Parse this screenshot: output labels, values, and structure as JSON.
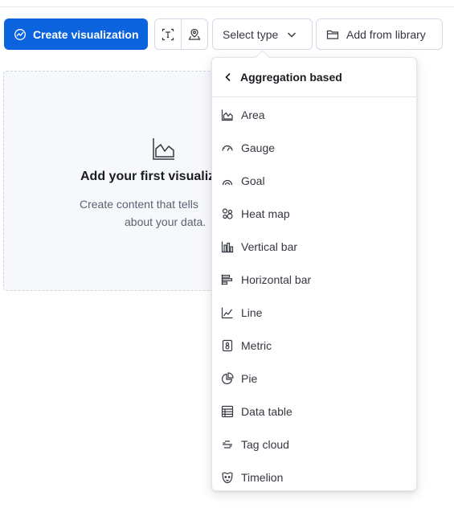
{
  "toolbar": {
    "create_label": "Create visualization",
    "select_label": "Select type",
    "library_label": "Add from library",
    "icons": [
      "text-icon",
      "map-icon"
    ]
  },
  "empty_state": {
    "title": "Add your first visualiz",
    "description_line1": "Create content that tells",
    "description_line2": "about your data."
  },
  "dropdown": {
    "title": "Aggregation based",
    "items": [
      {
        "label": "Area",
        "icon": "area-chart-icon"
      },
      {
        "label": "Gauge",
        "icon": "gauge-icon"
      },
      {
        "label": "Goal",
        "icon": "goal-icon"
      },
      {
        "label": "Heat map",
        "icon": "heatmap-icon"
      },
      {
        "label": "Vertical bar",
        "icon": "vertical-bar-icon"
      },
      {
        "label": "Horizontal bar",
        "icon": "horizontal-bar-icon"
      },
      {
        "label": "Line",
        "icon": "line-chart-icon"
      },
      {
        "label": "Metric",
        "icon": "metric-icon"
      },
      {
        "label": "Pie",
        "icon": "pie-chart-icon"
      },
      {
        "label": "Data table",
        "icon": "data-table-icon"
      },
      {
        "label": "Tag cloud",
        "icon": "tag-cloud-icon"
      },
      {
        "label": "Timelion",
        "icon": "timelion-icon"
      }
    ]
  },
  "colors": {
    "primary": "#0b64dd",
    "border": "#d3dae6",
    "text": "#343741",
    "panel_bg": "#f7f8fc"
  }
}
